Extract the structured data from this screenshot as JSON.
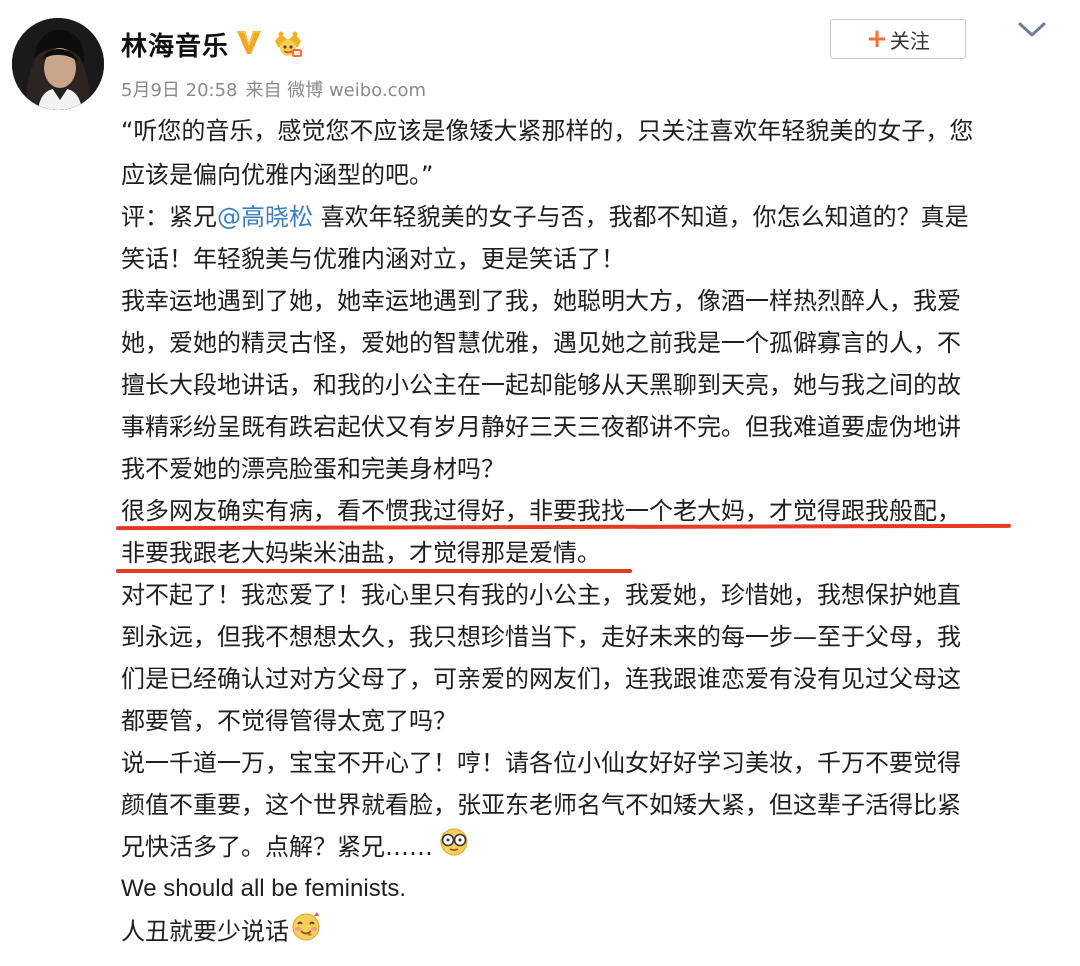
{
  "user": {
    "name": "林海音乐",
    "avatar_icon": "avatar-photo",
    "verified_icon": "verified-v-icon",
    "member_icon": "vip-crown-icon"
  },
  "post_meta": {
    "date": "5月9日 20:58",
    "source": "来自 微博 weibo.com"
  },
  "follow_button": {
    "plus": "+",
    "label": "关注"
  },
  "menu_icon": "chevron-down-icon",
  "colors": {
    "link": "#3b7fc4",
    "follow_plus": "#f77234",
    "underline": "#e53b25",
    "meta": "#8a8a8a"
  },
  "content": {
    "lines": [
      "“听您的音乐，感觉您不应该是像矮大紧那样的，只关注喜欢年轻貌美的女子，您",
      "应该是偏向优雅内涵型的吧。”",
      "",
      "笑话！年轻貌美与优雅内涵对立，更是笑话了！",
      "我幸运地遇到了她，她幸运地遇到了我，她聪明大方，像酒一样热烈醉人，我爱",
      "她，爱她的精灵古怪，爱她的智慧优雅，遇见她之前我是一个孤僻寡言的人，不",
      "擅长大段地讲话，和我的小公主在一起却能够从天黑聊到天亮，她与我之间的故",
      "事精彩纷呈既有跌宕起伏又有岁月静好三天三夜都讲不完。但我难道要虚伪地讲",
      "我不爱她的漂亮脸蛋和完美身材吗？",
      "很多网友确实有病，看不惯我过得好，非要我找一个老大妈，才觉得跟我般配，",
      "非要我跟老大妈柴米油盐，才觉得那是爱情。",
      "对不起了！我恋爱了！我心里只有我的小公主，我爱她，珍惜她，我想保护她直",
      "到永远，但我不想想太久，我只想珍惜当下，走好未来的每一步—至于父母，我",
      "们是已经确认过对方父母了，可亲爱的网友们，连我跟谁恋爱有没有见过父母这",
      "都要管，不觉得管得太宽了吗？",
      "说一千道一万，宝宝不开心了！哼！请各位小仙女好好学习美妆，千万不要觉得",
      "颜值不重要，这个世界就看脸，张亚东老师名气不如矮大紧，但这辈子活得比紧",
      "兄快活多了。点解？紧兄……",
      "We should all be feminists.",
      "人丑就要少说话"
    ],
    "mention_line": {
      "prefix": "评：紧兄",
      "mention": "@高晓松",
      "suffix": " 喜欢年轻貌美的女子与否，我都不知道，你怎么知道的？真是"
    },
    "emoji_1": "glasses-face-emoji",
    "emoji_2": "yummy-face-emoji"
  }
}
